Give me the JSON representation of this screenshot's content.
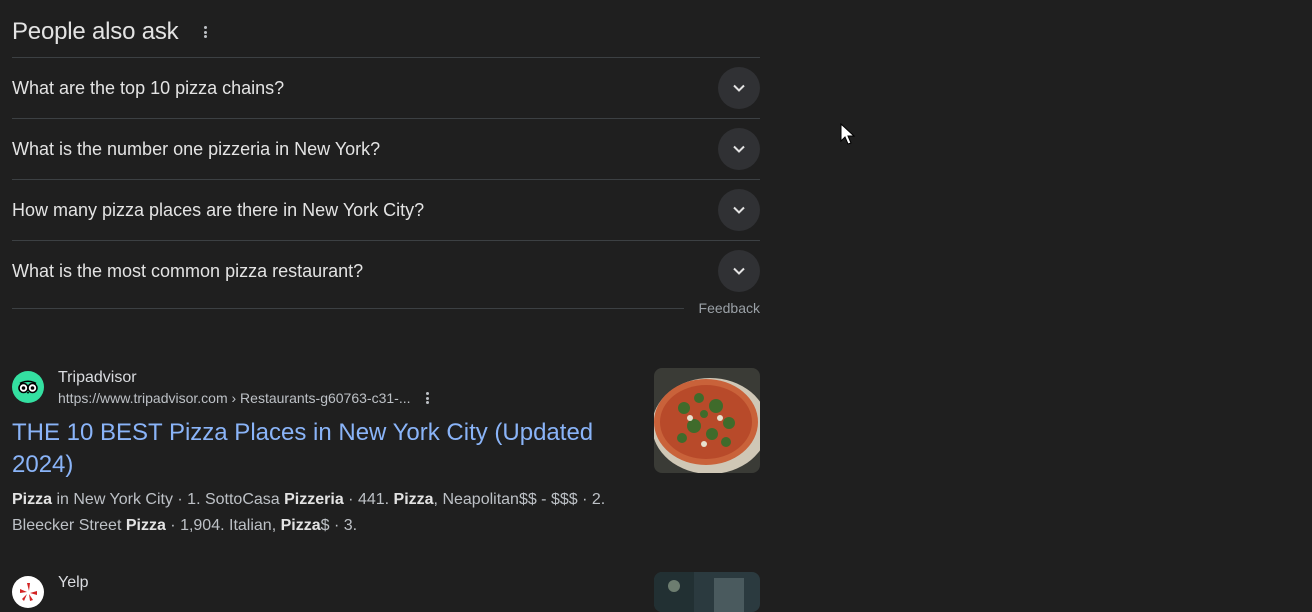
{
  "paa": {
    "title": "People also ask",
    "questions": [
      "What are the top 10 pizza chains?",
      "What is the number one pizzeria in New York?",
      "How many pizza places are there in New York City?",
      "What is the most common pizza restaurant?"
    ],
    "feedback": "Feedback"
  },
  "results": [
    {
      "site": "Tripadvisor",
      "url": "https://www.tripadvisor.com › Restaurants-g60763-c31-...",
      "title": "THE 10 BEST Pizza Places in New York City (Updated 2024)",
      "snippet": [
        {
          "t": "Pizza",
          "b": true
        },
        {
          "t": " in New York City · 1. SottoCasa ",
          "b": false
        },
        {
          "t": "Pizzeria",
          "b": true
        },
        {
          "t": " · 441. ",
          "b": false
        },
        {
          "t": "Pizza",
          "b": true
        },
        {
          "t": ", Neapolitan$$ - $$$ · 2. Bleecker Street ",
          "b": false
        },
        {
          "t": "Pizza",
          "b": true
        },
        {
          "t": " · 1,904. Italian, ",
          "b": false
        },
        {
          "t": "Pizza",
          "b": true
        },
        {
          "t": "$ · 3.",
          "b": false
        }
      ],
      "favicon": "tripadvisor-owl-icon",
      "favicon_color": "#34e0a1"
    },
    {
      "site": "Yelp",
      "favicon": "yelp-burst-icon",
      "favicon_color": "#d32323"
    }
  ],
  "colors": {
    "background": "#1f1f1f",
    "link": "#8ab4f8",
    "divider": "#3c4043"
  }
}
